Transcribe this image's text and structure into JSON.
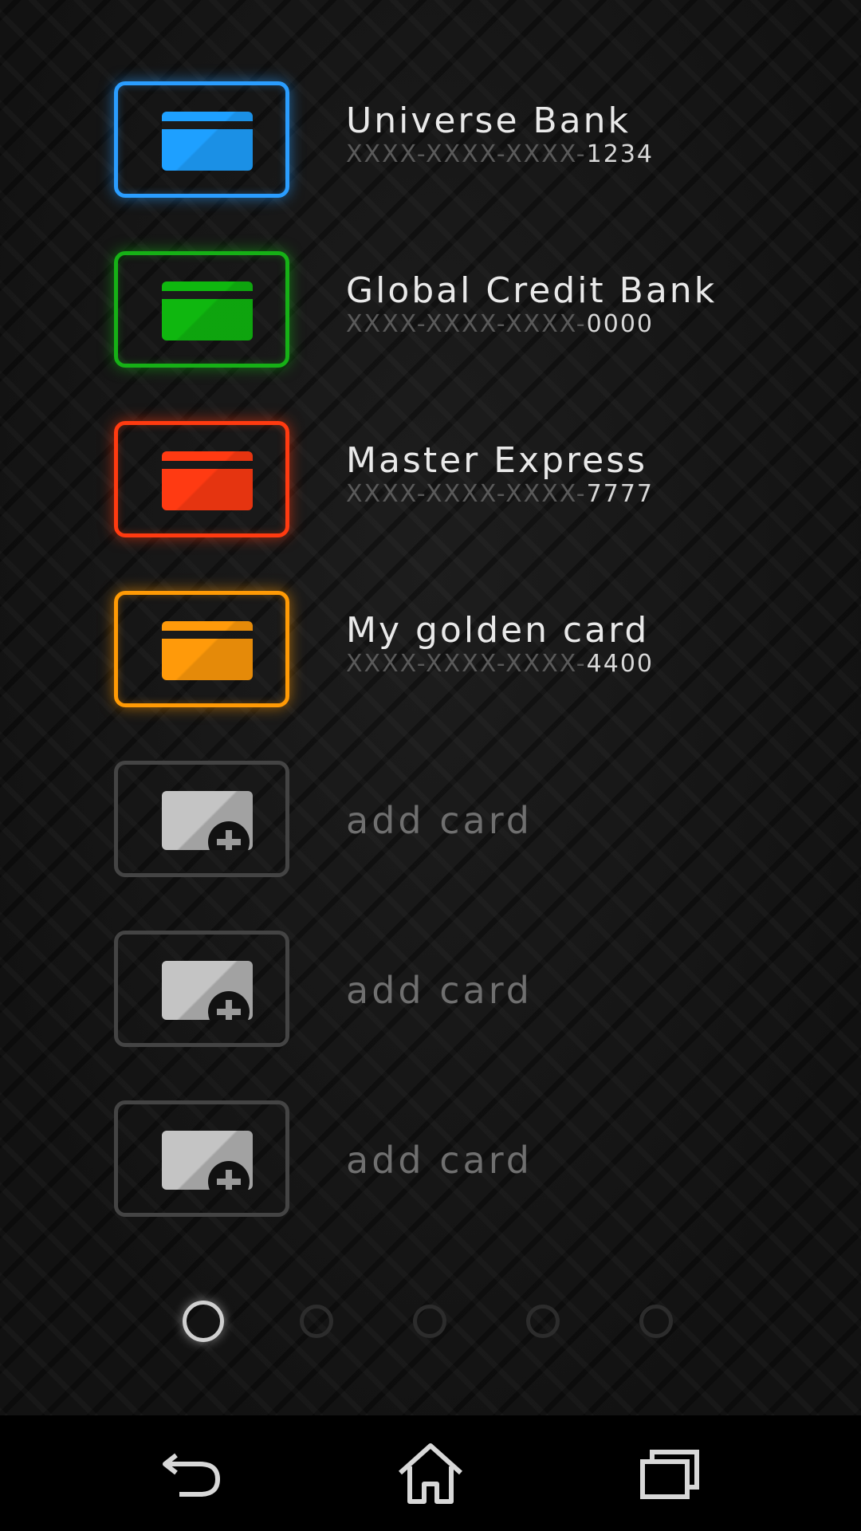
{
  "cards": [
    {
      "name": "Universe Bank",
      "number_mask": "XXXX-XXXX-XXXX-",
      "number_last": "1234",
      "color": "#2a9dff",
      "icon_color": "#1ea0ff"
    },
    {
      "name": "Global Credit Bank",
      "number_mask": "XXXX-XXXX-XXXX-",
      "number_last": "0000",
      "color": "#16b016",
      "icon_color": "#0fb70f"
    },
    {
      "name": "Master Express",
      "number_mask": "XXXX-XXXX-XXXX-",
      "number_last": "7777",
      "color": "#ff3a10",
      "icon_color": "#ff3a12"
    },
    {
      "name": "My golden card",
      "number_mask": "XXXX-XXXX-XXXX-",
      "number_last": "4400",
      "color": "#ff9a05",
      "icon_color": "#ff9a0a"
    }
  ],
  "add_slots": [
    {
      "label": "add card"
    },
    {
      "label": "add card"
    },
    {
      "label": "add card"
    }
  ],
  "pager": {
    "total": 5,
    "active_index": 0
  },
  "navbar": {
    "icons": [
      "back-icon",
      "home-icon",
      "recent-apps-icon"
    ]
  },
  "colors": {
    "background": "#161616",
    "inactive_frame": "#444444",
    "navbar": "#000000"
  }
}
